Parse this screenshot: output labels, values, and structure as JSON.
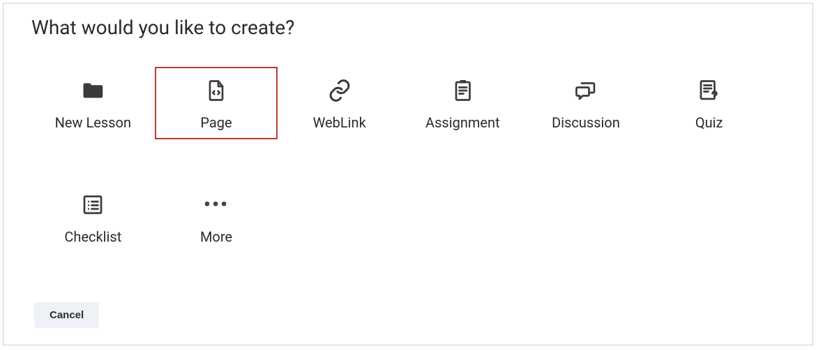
{
  "dialog": {
    "title": "What would you like to create?",
    "cancel_label": "Cancel",
    "selected_index": 1
  },
  "options": [
    {
      "label": "New Lesson",
      "icon": "folder-icon"
    },
    {
      "label": "Page",
      "icon": "page-code-icon"
    },
    {
      "label": "WebLink",
      "icon": "link-icon"
    },
    {
      "label": "Assignment",
      "icon": "assignment-icon"
    },
    {
      "label": "Discussion",
      "icon": "discussion-icon"
    },
    {
      "label": "Quiz",
      "icon": "quiz-icon"
    },
    {
      "label": "Checklist",
      "icon": "checklist-icon"
    },
    {
      "label": "More",
      "icon": "more-icon"
    }
  ]
}
